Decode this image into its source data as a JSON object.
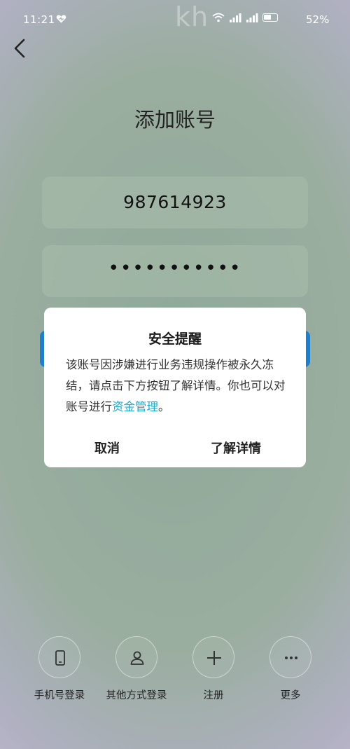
{
  "status_bar": {
    "time": "11:21",
    "watermark": "kh",
    "battery": "52%",
    "icons": [
      "heart-icon",
      "wifi-icon",
      "signal-icon",
      "battery-icon"
    ]
  },
  "header": {
    "back_icon": "chevron-left-icon",
    "title": "添加账号"
  },
  "form": {
    "account_value": "987614923",
    "password_value": "•••••••••••"
  },
  "dialog": {
    "title": "安全提醒",
    "body_prefix": "该账号因涉嫌进行业务违规操作被永久冻结，请点击下方按钮了解详情。你也可以对账号进行",
    "body_link": "资金管理",
    "body_suffix": "。",
    "cancel_label": "取消",
    "details_label": "了解详情"
  },
  "bottom_bar": {
    "items": [
      {
        "label": "手机号登录",
        "icon": "phone-icon"
      },
      {
        "label": "其他方式登录",
        "icon": "person-icon"
      },
      {
        "label": "注册",
        "icon": "plus-icon"
      },
      {
        "label": "更多",
        "icon": "more-icon"
      }
    ]
  },
  "colors": {
    "accent_link": "#1ea8c9",
    "hidden_button": "#1f7fc8",
    "dialog_bg": "#ffffff"
  }
}
